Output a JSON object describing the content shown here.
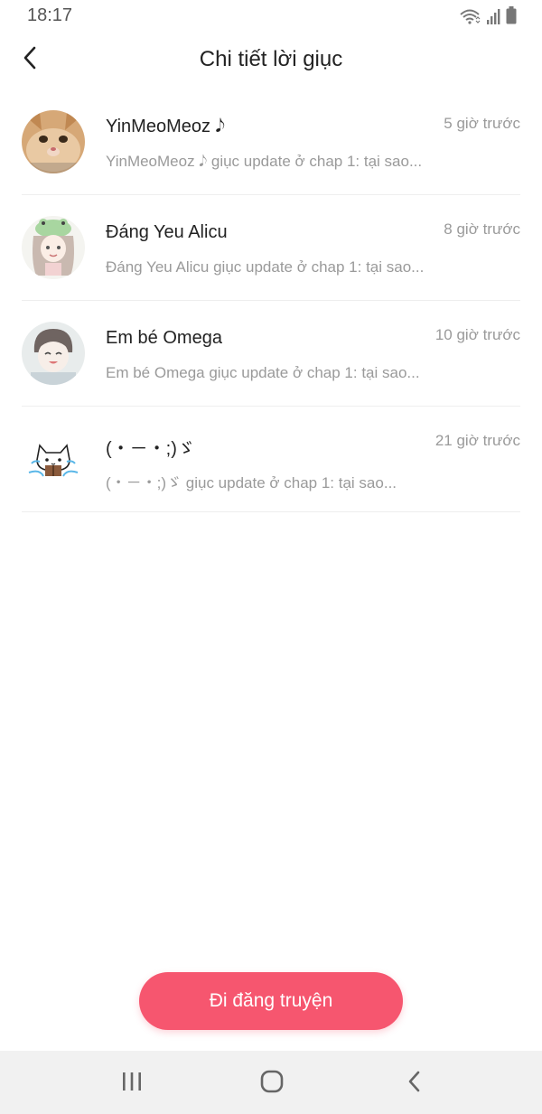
{
  "status_bar": {
    "time": "18:17",
    "icons": [
      "wifi-icon",
      "signal-icon",
      "battery-icon"
    ]
  },
  "header": {
    "title": "Chi tiết lời giục",
    "back_icon": "chevron-left-icon"
  },
  "list": {
    "items": [
      {
        "name": "YinMeoMeoz 𝅘𝅥𝅮",
        "time": "5 giờ trước",
        "message": "YinMeoMeoz 𝅘𝅥𝅮 giục update ở chap 1: tại sao...",
        "avatar": "cat-photo-avatar"
      },
      {
        "name": "Đáng Yeu Alicu",
        "time": "8 giờ trước",
        "message": "Đáng Yeu Alicu giục update ở chap 1: tại sao...",
        "avatar": "frog-hat-girl-avatar"
      },
      {
        "name": "Em bé Omega",
        "time": "10 giờ trước",
        "message": "Em bé Omega giục update ở chap 1: tại sao...",
        "avatar": "smiling-boy-avatar"
      },
      {
        "name": "(・－・;)ゞ",
        "time": "21 giờ trước",
        "message": "(・－・;)ゞ giục update ở chap 1: tại sao...",
        "avatar": "cat-reading-book-avatar"
      }
    ]
  },
  "actions": {
    "post_label": "Đi đăng truyện"
  },
  "nav_bar": {
    "icons": [
      "recents-icon",
      "home-icon",
      "back-icon"
    ]
  },
  "colors": {
    "accent": "#f6566f",
    "secondary_text": "#9a9a9a",
    "nav_background": "#f1f1f1"
  }
}
